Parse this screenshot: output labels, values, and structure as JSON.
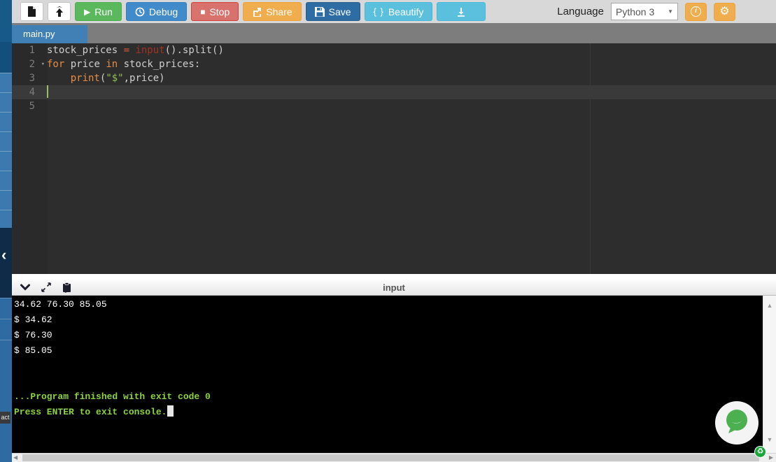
{
  "toolbar": {
    "run": "Run",
    "debug": "Debug",
    "stop": "Stop",
    "share": "Share",
    "save": "Save",
    "beautify": "Beautify",
    "language_label": "Language",
    "language_value": "Python 3"
  },
  "tab": {
    "name": "main.py"
  },
  "editor": {
    "lines": [
      {
        "no": "1",
        "tokens": [
          [
            "stock_prices ",
            "plain"
          ],
          [
            "=",
            "op"
          ],
          [
            " ",
            "plain"
          ],
          [
            "input",
            "builtin"
          ],
          [
            "().split()",
            "plain"
          ]
        ]
      },
      {
        "no": "2",
        "fold": true,
        "tokens": [
          [
            "for",
            "kw"
          ],
          [
            " price ",
            "plain"
          ],
          [
            "in",
            "kw"
          ],
          [
            " stock_prices:",
            "plain"
          ]
        ]
      },
      {
        "no": "3",
        "tokens": [
          [
            "    ",
            "plain"
          ],
          [
            "print",
            "kw"
          ],
          [
            "(",
            "plain"
          ],
          [
            "\"$\"",
            "str"
          ],
          [
            ",price)",
            "plain"
          ]
        ]
      },
      {
        "no": "4",
        "active": true,
        "cursor": true,
        "tokens": []
      },
      {
        "no": "5",
        "tokens": []
      }
    ]
  },
  "console": {
    "title": "input",
    "lines": [
      {
        "text": "34.62 76.30 85.05",
        "color": "white"
      },
      {
        "text": "$ 34.62",
        "color": "white"
      },
      {
        "text": "$ 76.30",
        "color": "white"
      },
      {
        "text": "$ 85.05",
        "color": "white"
      },
      {
        "text": "",
        "color": "white"
      },
      {
        "text": "",
        "color": "white"
      },
      {
        "text": "...Program finished with exit code 0",
        "color": "green"
      },
      {
        "text": "Press ENTER to exit console.",
        "color": "green",
        "cursor": true
      }
    ]
  },
  "sidebar": {
    "contact": "act"
  },
  "icons": {
    "run": "▶",
    "stop": "■",
    "beautify": "{ }",
    "select_caret": "▼",
    "fold": "▾",
    "gear": "⚙",
    "info": "i",
    "sidebar_collapse": "‹",
    "scroll_left": "◀",
    "scroll_right": "▶",
    "scroll_up": "▲",
    "scroll_down": "▼",
    "recycle": "♻"
  },
  "colors": {
    "run_green": "#5cb85c",
    "debug_blue": "#428bca",
    "stop_red": "#d9716d",
    "share_orange": "#f0ad4e",
    "save_blue": "#2e6da4",
    "beautify_cyan": "#5bc0de",
    "accent_orange": "#f0ad4e",
    "tab_blue": "#4080b5",
    "editor_bg": "#2d2d2d",
    "keyword_orange": "#e78c45",
    "builtin_red": "#a23222",
    "string_green": "#90c04e",
    "console_green": "#8dd33f"
  }
}
